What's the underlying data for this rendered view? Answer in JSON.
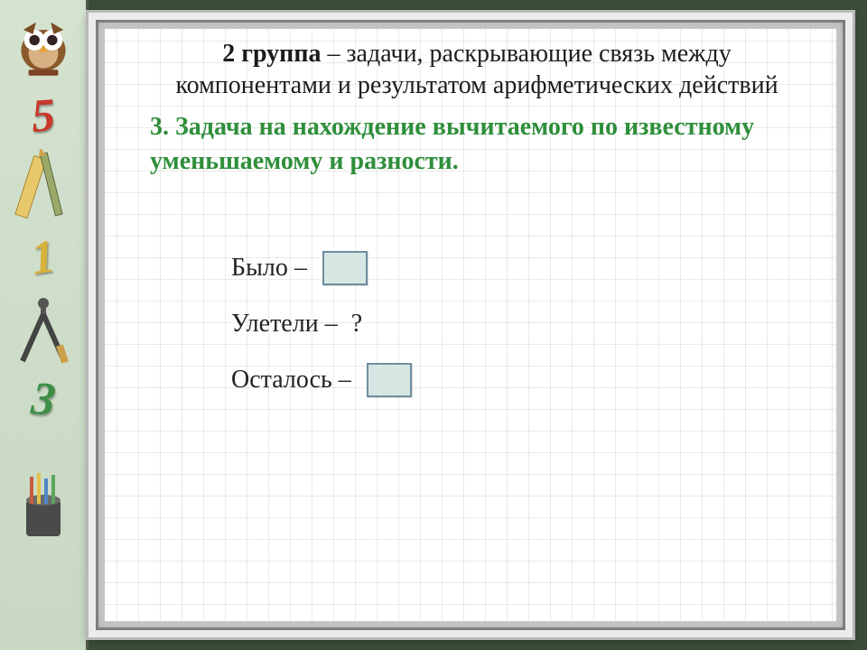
{
  "slide": {
    "subtitle_bold": "2 группа",
    "subtitle_rest": " – задачи, раскрывающие связь между компонентами и результатом арифметических действий",
    "task_number": "3",
    "task_title": ". Задача на нахождение вычитаемого по известному уменьшаемому и разности.",
    "rows": [
      {
        "label": "Было – ",
        "kind": "slot"
      },
      {
        "label": "Улетели – ",
        "kind": "question",
        "question": "?"
      },
      {
        "label": "Осталось – ",
        "kind": "slot"
      }
    ]
  },
  "sidebar": {
    "digits": [
      "5",
      "1",
      "3"
    ],
    "mascot_name": "owl-mascot",
    "tools": [
      "ruler-pencil-icon",
      "compass-icon",
      "pencil-cup-icon"
    ]
  },
  "colors": {
    "task_green": "#2f8f3b",
    "slot_fill": "#d6e7e3",
    "slot_border": "#6e8fa0"
  }
}
